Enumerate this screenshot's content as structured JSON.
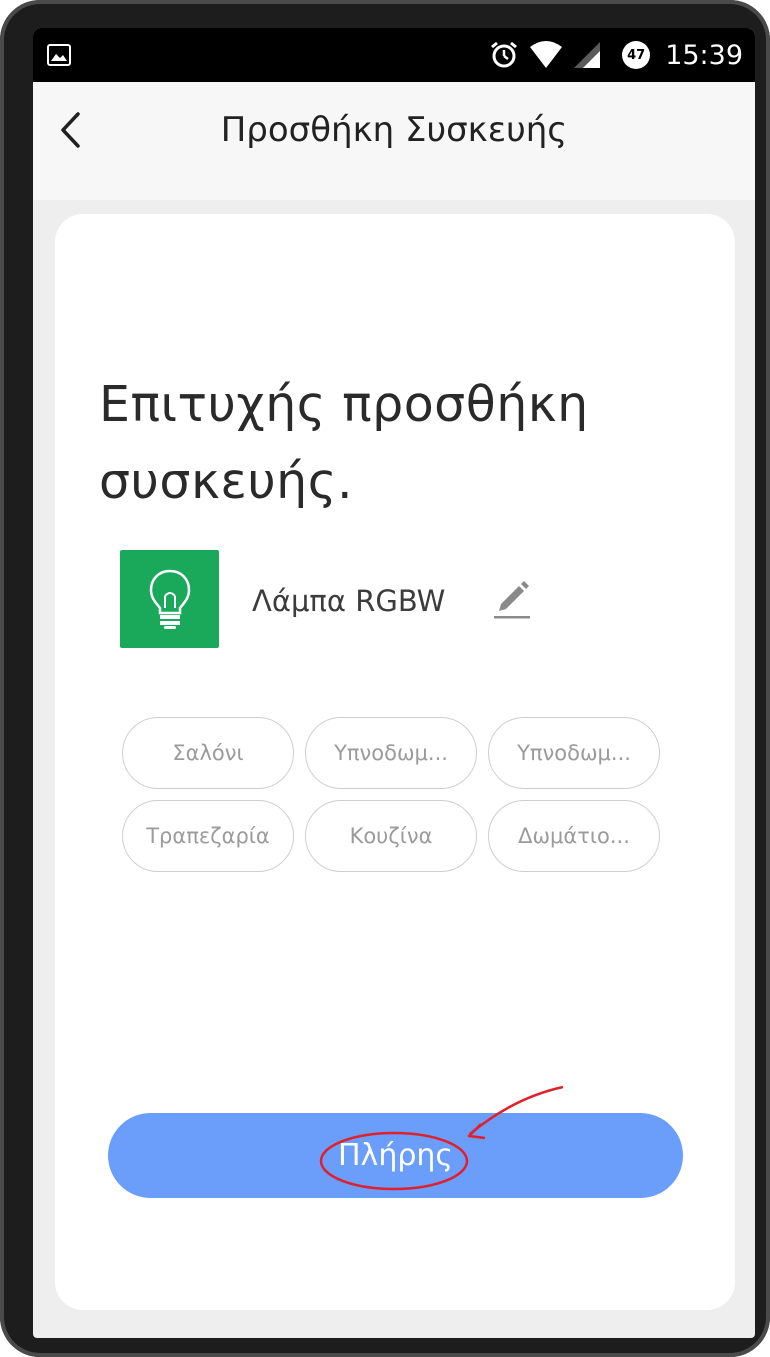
{
  "status_bar": {
    "time": "15:39",
    "notification_badge": "47",
    "icons": [
      "image-icon",
      "alarm-icon",
      "wifi-icon",
      "signal-icon",
      "badge-icon"
    ]
  },
  "app_bar": {
    "title": "Προσθήκη Συσκευής",
    "back_icon": "chevron-left-icon"
  },
  "content": {
    "headline_line1": "Επιτυχής προσθήκη",
    "headline_line2": "συσκευής.",
    "device": {
      "name": "Λάμπα RGBW",
      "icon": "lightbulb-icon",
      "icon_bg": "#1aa85b",
      "edit_icon": "pencil-icon"
    },
    "rooms": [
      "Σαλόνι",
      "Υπνοδωμ...",
      "Υπνοδωμ...",
      "Τραπεζαρία",
      "Κουζίνα",
      "Δωμάτιο..."
    ],
    "done_label": "Πλήρης"
  },
  "colors": {
    "primary_button": "#6b9dfb",
    "annotation": "#e0202c"
  }
}
